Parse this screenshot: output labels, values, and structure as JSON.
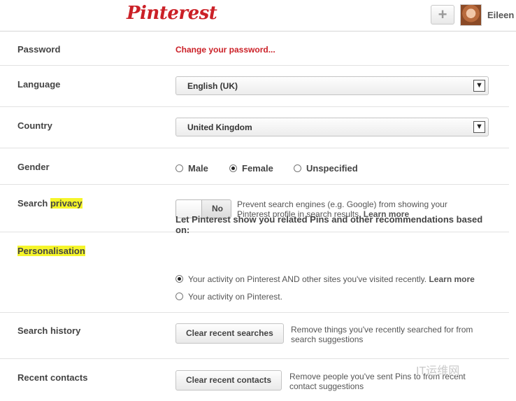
{
  "header": {
    "logo_text": "Pinterest",
    "add_label": "+",
    "user_name": "Eileen"
  },
  "password": {
    "label": "Password",
    "link": "Change your password..."
  },
  "language": {
    "label": "Language",
    "value": "English (UK)"
  },
  "country": {
    "label": "Country",
    "value": "United Kingdom"
  },
  "gender": {
    "label": "Gender",
    "options": [
      "Male",
      "Female",
      "Unspecified"
    ],
    "selected": "Female"
  },
  "search_privacy": {
    "label_prefix": "Search ",
    "label_highlight": "privacy",
    "toggle_value": "No",
    "description": "Prevent search engines (e.g. Google) from showing your Pinterest profile in search results.",
    "learn_more": "Learn more"
  },
  "personalisation": {
    "label": "Personalisation",
    "title": "Let Pinterest show you related Pins and other recommendations based on:",
    "option1": "Your activity on Pinterest AND other sites you've visited recently.",
    "option1_learn_more": "Learn more",
    "option2": "Your activity on Pinterest."
  },
  "search_history": {
    "label": "Search history",
    "button": "Clear recent searches",
    "description": "Remove things you've recently searched for from search suggestions"
  },
  "recent_contacts": {
    "label": "Recent contacts",
    "button": "Clear recent contacts",
    "description": "Remove people you've sent Pins to from recent contact suggestions"
  },
  "watermark": "IT运维网",
  "colors": {
    "brand": "#cb2027",
    "highlight": "#f5f52a"
  }
}
